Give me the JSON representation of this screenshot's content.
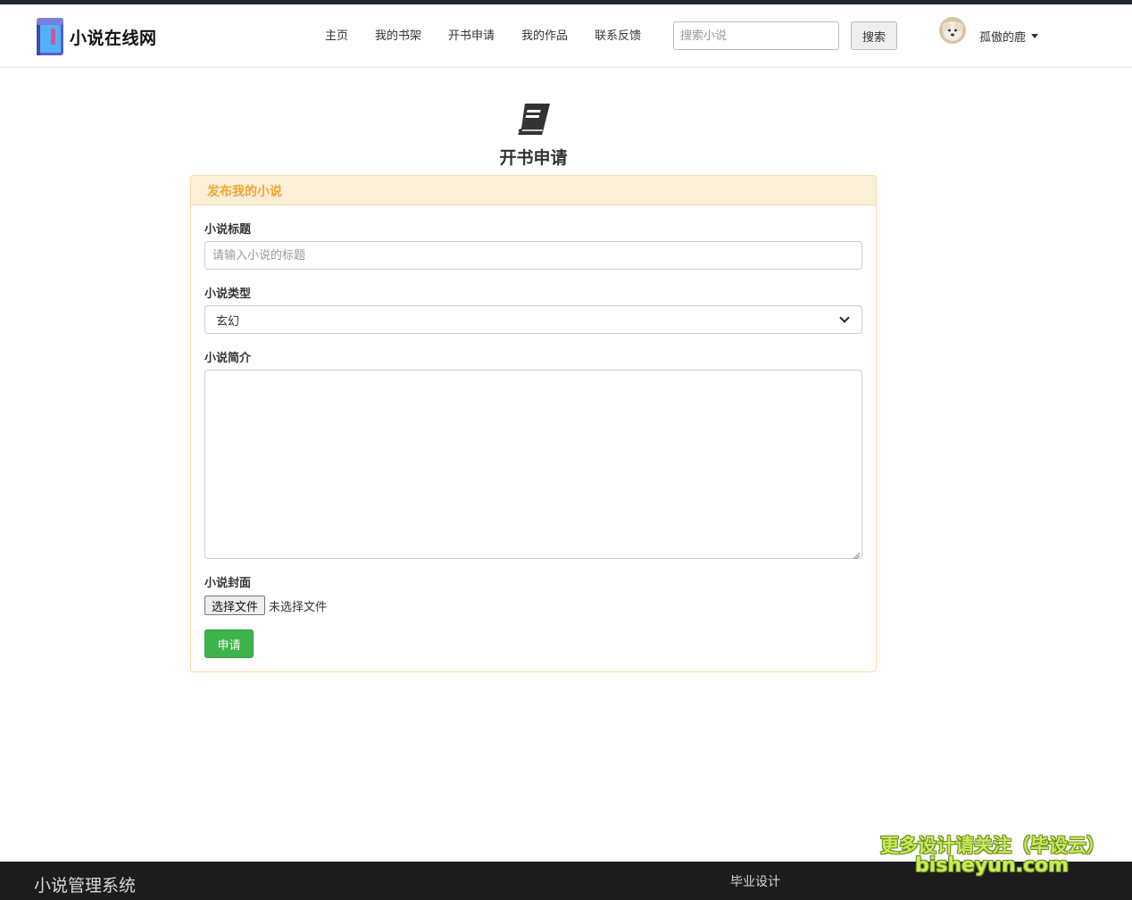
{
  "site": {
    "brand_name": "小说在线网",
    "logo_icon": "book-icon"
  },
  "nav": {
    "items": [
      {
        "label": "主页"
      },
      {
        "label": "我的书架"
      },
      {
        "label": "开书申请"
      },
      {
        "label": "我的作品"
      },
      {
        "label": "联系反馈"
      }
    ],
    "search_placeholder": "搜索小说",
    "search_button": "搜索",
    "username": "孤傲的鹿"
  },
  "page": {
    "icon": "book-icon",
    "title": "开书申请"
  },
  "form": {
    "panel_title": "发布我的小说",
    "title_label": "小说标题",
    "title_placeholder": "请输入小说的标题",
    "type_label": "小说类型",
    "type_selected": "玄幻",
    "intro_label": "小说简介",
    "cover_label": "小说封面",
    "file_button": "选择文件",
    "file_status": "未选择文件",
    "submit_label": "申请"
  },
  "footer": {
    "title": "小说管理系统",
    "link": "毕业设计"
  },
  "watermark": {
    "line1": "更多设计请关注（毕设云）",
    "line2": "bisheyun.com"
  },
  "colors": {
    "accent_orange": "#f0a534",
    "panel_bg": "#fcefd7",
    "success_green": "#3cb44b",
    "footer_bg": "#1c1c1c"
  }
}
